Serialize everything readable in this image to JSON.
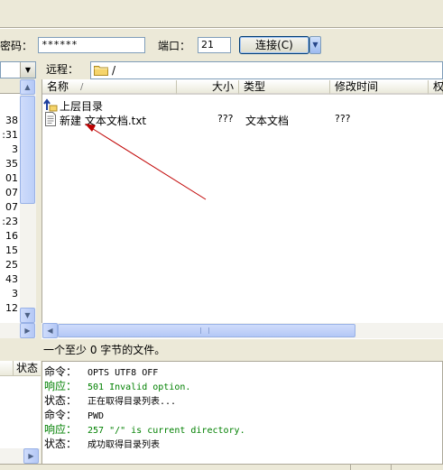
{
  "quickconnect": {
    "password_label": "密码：",
    "password_value": "******",
    "port_label": "端口：",
    "port_value": "21",
    "connect_label": "连接(C)"
  },
  "local": {
    "row_fragments": [
      "38",
      ":31",
      "3",
      "35",
      "01",
      "07",
      "07",
      ":23",
      "16",
      "15",
      "25",
      "43",
      "3",
      "12"
    ]
  },
  "remote": {
    "label": "远程：",
    "path": "/",
    "columns": {
      "name": "名称",
      "name_sort": "/",
      "size": "大小",
      "type": "类型",
      "modified": "修改时间",
      "extra": "权"
    },
    "parent_dir": "上层目录",
    "files": [
      {
        "name": "新建 文本文档.txt",
        "size": "???",
        "type": "文本文档",
        "modified": "???"
      }
    ],
    "status": "一个至少 0 字节的文件。"
  },
  "queue": {
    "header": "状态"
  },
  "log": [
    {
      "kind": "命令：",
      "text": "OPTS UTF8 OFF",
      "color": "#000000"
    },
    {
      "kind": "响应：",
      "text": "501 Invalid option.",
      "color": "#008000"
    },
    {
      "kind": "状态：",
      "text": "正在取得目录列表...",
      "color": "#000000"
    },
    {
      "kind": "命令：",
      "text": "PWD",
      "color": "#000000"
    },
    {
      "kind": "响应：",
      "text": "257 \"/\" is current directory.",
      "color": "#008000"
    },
    {
      "kind": "状态：",
      "text": "成功取得目录列表",
      "color": "#000000"
    }
  ],
  "colors": {
    "annotation_arrow": "#c00000",
    "folder": "#f5d46b",
    "response_green": "#008000"
  }
}
